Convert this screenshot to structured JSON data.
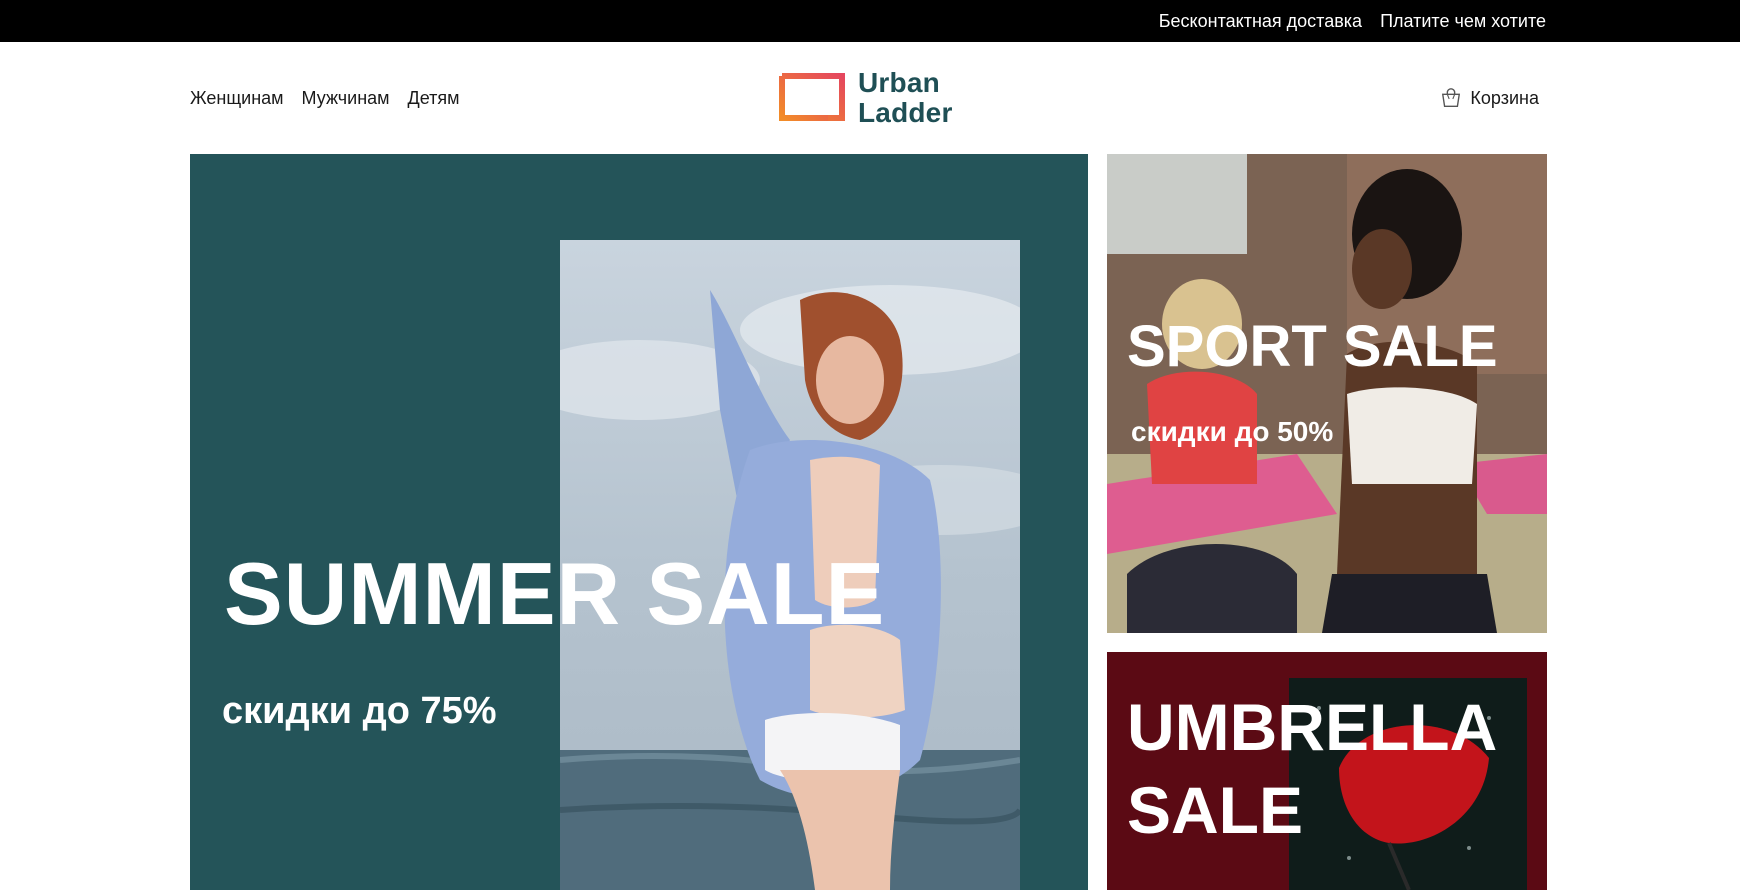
{
  "topbar": {
    "links": [
      "Бесконтактная доставка",
      "Платите чем хотите"
    ]
  },
  "nav": {
    "items": [
      "Женщинам",
      "Мужчинам",
      "Детям"
    ]
  },
  "logo": {
    "line1": "Urban",
    "line2": "Ladder",
    "color_text": "#1f4f55",
    "gradient": [
      "#f28c28",
      "#e5475e"
    ]
  },
  "cart": {
    "label": "Корзина",
    "icon": "shopping-bag-icon"
  },
  "banners": {
    "main": {
      "title": "SUMMER SALE",
      "subtitle": "скидки до 75%",
      "bg": "#245459"
    },
    "sport": {
      "title": "SPORT SALE",
      "subtitle": "скидки до 50%"
    },
    "umbrella": {
      "title_line1": "UMBRELLA",
      "title_line2": "SALE",
      "bg": "#5b0a14"
    }
  }
}
